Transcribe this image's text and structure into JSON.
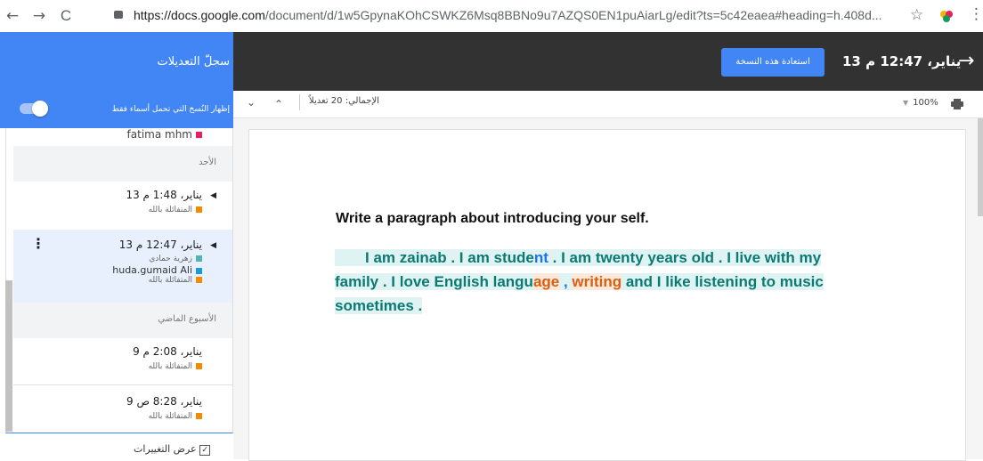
{
  "browser": {
    "back": "←",
    "forward": "→",
    "reload": "C",
    "url_host": "https://docs.google.com",
    "url_path": "/document/d/1w5GpynaKOhCSWKZ6Msq8BBNo9u7AZQS0EN1puAiarLg/edit?ts=5c42eaea#heading=h.408d...",
    "star": "☆",
    "menu": "⋮"
  },
  "header": {
    "sidebar_title": "سجلّ التعديلات",
    "restore_label": "استعادة هذه النسخة",
    "version_time": "13 يناير، 12:47 م",
    "back_arrow": "→"
  },
  "toolbar": {
    "total_changes": "الإجمالي: 20 تعديلاً",
    "zoom": "100%",
    "toggle_label": "إظهار النُسخ التي تحمل أسماء فقط"
  },
  "sidebar": {
    "top_name": "fatima mhm",
    "sections": [
      {
        "label": "الأحد"
      },
      {
        "label": "الأسبوع الماضي"
      }
    ],
    "entries": [
      {
        "date": "13 يناير، 1:48 م",
        "names": [
          "المتفائلة بالله"
        ]
      },
      {
        "date": "13 يناير، 12:47 م",
        "names": [
          "زهرية حمادي",
          "huda.gumaid Ali",
          "المتفائلة بالله"
        ]
      },
      {
        "date": "9 يناير، 2:08 م",
        "names": [
          "المتفائلة بالله"
        ]
      },
      {
        "date": "9 يناير، 8:28 ص",
        "names": [
          "المتفائلة بالله"
        ]
      }
    ],
    "show_changes": "عرض التغييرات"
  },
  "document": {
    "heading": "Write a paragraph about introducing your self.",
    "body_parts": [
      "I am zainab . I am stude",
      "nt",
      " . I am twenty years old",
      " . I live with my family . I love English langu",
      "age",
      " , ",
      "writing",
      " and I like listening to music sometimes ."
    ]
  },
  "colors": {
    "accent": "#4285f4",
    "dark_bar": "#323232",
    "author_orange": "#f28b00",
    "author_blue": "#1a9bd7",
    "author_pink": "#e91e63",
    "author_teal": "#4fb5b0"
  }
}
